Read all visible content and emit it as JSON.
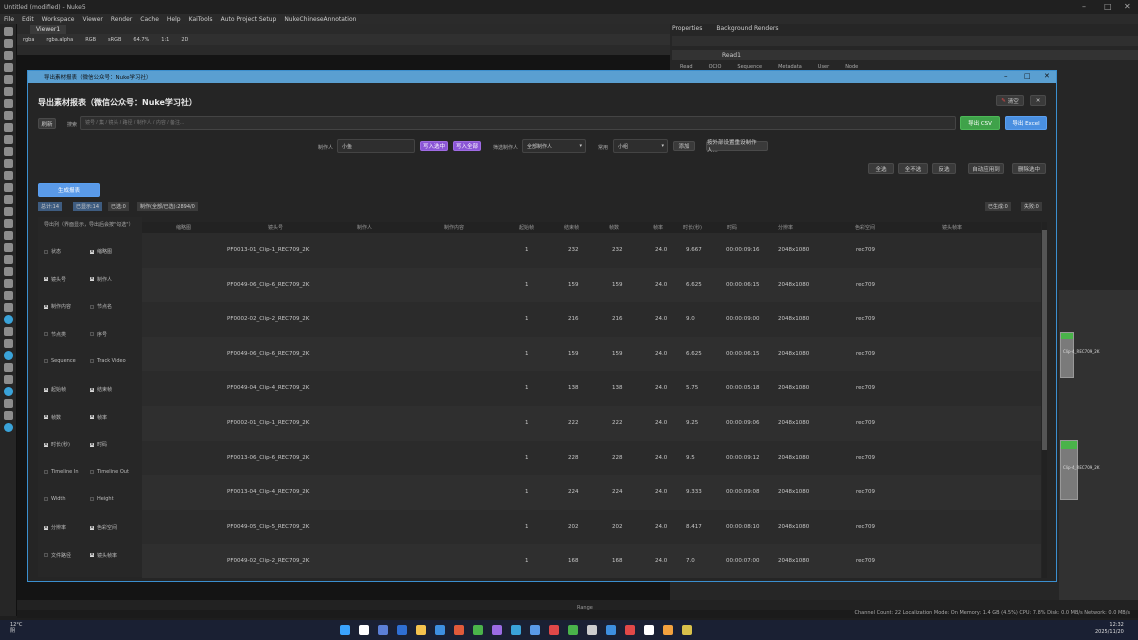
{
  "nuke": {
    "title": "Untitled (modified) - Nuke5",
    "menu": [
      "File",
      "Edit",
      "Workspace",
      "Viewer",
      "Render",
      "Cache",
      "Help",
      "KaiTools",
      "Auto Project Setup",
      "NukeChineseAnnotation"
    ],
    "viewer_tab": "Viewer1",
    "viewer_controls": [
      "rgba",
      "rgba.alpha",
      "RGB",
      "sRGB",
      "64.7%",
      "1:1",
      "2D"
    ],
    "panel_tabs": [
      "Properties",
      "Background Renders"
    ],
    "read_node": "Read1",
    "read_tabs": [
      "Read",
      "OCIO",
      "Sequence",
      "Metadata",
      "User",
      "Node"
    ],
    "timeline_range": "Range",
    "status": "Channel Count: 22  Localization Mode: On  Memory: 1.4 GB (4.5%)  CPU: 7.8%  Disk: 0.0 MB/s  Network: 0.0 MB/s",
    "nodes": [
      {
        "label": "Clip-4_REC709_2K"
      },
      {
        "label": "Clip-4_REC709_2K"
      }
    ]
  },
  "taskbar": {
    "weather_temp": "12°C",
    "weather_desc": "阴",
    "time": "12:32",
    "date": "2025/11/20"
  },
  "dialog": {
    "title": "导出素材报表（微信公众号：Nuke学习社）",
    "heading": "导出素材报表（微信公众号：Nuke学习社）",
    "clear_btn": "清空",
    "close_btn": "✕",
    "refresh_btn": "刷新",
    "search_label": "搜索",
    "search_placeholder": "镜号 / 集 / 镜头 / 路径 / 制作人 / 内容 / 备注...",
    "export_csv": "导出 CSV",
    "export_excel": "导出 Excel",
    "producer_label": "制作人",
    "producer_value": "小鱼",
    "write_selected": "写入选中",
    "write_all": "写入全部",
    "filter_producer_label": "筛选制作人",
    "filter_producer_value": "全部制作人",
    "quality_label": "常用",
    "quality_value": "小组",
    "add_btn": "添加",
    "hint_btn": "按外部设置重设制作人...",
    "select_all": "全选",
    "select_none": "全不选",
    "invert": "反选",
    "auto_preview": "自动应用到",
    "delete_selected": "删除选中",
    "generate_btn": "生成报表",
    "stats": [
      "总计:14",
      "已显示:14",
      "已选:0",
      "制作(全部/已选):2894/0"
    ],
    "right_stats": [
      "已生成:0",
      "失败:0"
    ],
    "cols_title": "导出列（界面显示，导出后会按\"勾选\"）",
    "checkboxes": [
      {
        "label": "状态",
        "on": false
      },
      {
        "label": "缩略图",
        "on": true
      },
      {
        "label": "镜头号",
        "on": true
      },
      {
        "label": "制作人",
        "on": true
      },
      {
        "label": "制作内容",
        "on": true
      },
      {
        "label": "节点名",
        "on": false
      },
      {
        "label": "节点类",
        "on": false
      },
      {
        "label": "序号",
        "on": false
      },
      {
        "label": "Sequence",
        "on": false
      },
      {
        "label": "Track Video",
        "on": false
      },
      {
        "label": "起始帧",
        "on": true
      },
      {
        "label": "结束帧",
        "on": true
      },
      {
        "label": "帧数",
        "on": true
      },
      {
        "label": "帧率",
        "on": true
      },
      {
        "label": "时长(秒)",
        "on": true
      },
      {
        "label": "时码",
        "on": true
      },
      {
        "label": "Timeline In",
        "on": false
      },
      {
        "label": "Timeline Out",
        "on": false
      },
      {
        "label": "Width",
        "on": false
      },
      {
        "label": "Height",
        "on": false
      },
      {
        "label": "分辨率",
        "on": true
      },
      {
        "label": "色彩空间",
        "on": true
      },
      {
        "label": "文件路径",
        "on": false
      },
      {
        "label": "镜头帧率",
        "on": true
      }
    ],
    "columns": [
      "缩略图",
      "镜头号",
      "制作人",
      "制作内容",
      "起始帧",
      "结束帧",
      "帧数",
      "帧率",
      "时长(秒)",
      "时码",
      "分辨率",
      "色彩空间",
      "镜头帧率"
    ],
    "rows": [
      [
        "PF0013-01_Clip-1_REC709_2K",
        "1",
        "232",
        "232",
        "24.0",
        "9.667",
        "00:00:09:16",
        "2048x1080",
        "rec709"
      ],
      [
        "PF0049-06_Clip-6_REC709_2K",
        "1",
        "159",
        "159",
        "24.0",
        "6.625",
        "00:00:06:15",
        "2048x1080",
        "rec709"
      ],
      [
        "PF0002-02_Clip-2_REC709_2K",
        "1",
        "216",
        "216",
        "24.0",
        "9.0",
        "00:00:09:00",
        "2048x1080",
        "rec709"
      ],
      [
        "PF0049-06_Clip-6_REC709_2K",
        "1",
        "159",
        "159",
        "24.0",
        "6.625",
        "00:00:06:15",
        "2048x1080",
        "rec709"
      ],
      [
        "PF0049-04_Clip-4_REC709_2K",
        "1",
        "138",
        "138",
        "24.0",
        "5.75",
        "00:00:05:18",
        "2048x1080",
        "rec709"
      ],
      [
        "PF0002-01_Clip-1_REC709_2K",
        "1",
        "222",
        "222",
        "24.0",
        "9.25",
        "00:00:09:06",
        "2048x1080",
        "rec709"
      ],
      [
        "PF0013-06_Clip-6_REC709_2K",
        "1",
        "228",
        "228",
        "24.0",
        "9.5",
        "00:00:09:12",
        "2048x1080",
        "rec709"
      ],
      [
        "PF0013-04_Clip-4_REC709_2K",
        "1",
        "224",
        "224",
        "24.0",
        "9.333",
        "00:00:09:08",
        "2048x1080",
        "rec709"
      ],
      [
        "PF0049-05_Clip-5_REC709_2K",
        "1",
        "202",
        "202",
        "24.0",
        "8.417",
        "00:00:08:10",
        "2048x1080",
        "rec709"
      ],
      [
        "PF0049-02_Clip-2_REC709_2K",
        "1",
        "168",
        "168",
        "24.0",
        "7.0",
        "00:00:07:00",
        "2048x1080",
        "rec709"
      ]
    ]
  }
}
